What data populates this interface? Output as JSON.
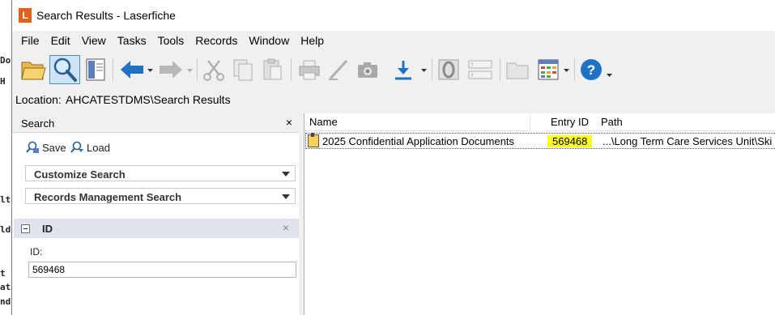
{
  "background_window": {
    "fragments": [
      "Doc",
      "H",
      "lt",
      "ld",
      "t",
      "at",
      "nd"
    ]
  },
  "window": {
    "title": "Search Results - Laserfiche",
    "logo_letter": "L"
  },
  "menu": [
    "File",
    "Edit",
    "View",
    "Tasks",
    "Tools",
    "Records",
    "Window",
    "Help"
  ],
  "toolbar": {
    "buttons": [
      "open-folder-icon",
      "search-icon",
      "preview-pane-icon",
      "back-icon",
      "forward-icon",
      "cut-icon",
      "copy-icon",
      "paste-icon",
      "print-icon",
      "annotate-icon",
      "scan-icon",
      "download-icon",
      "zone-ocr-icon",
      "fields-icon",
      "new-folder-icon",
      "column-view-icon",
      "help-icon"
    ],
    "accent": "#1f73c5"
  },
  "location": {
    "label": "Location:",
    "value": "AHCATESTDMS\\Search Results"
  },
  "search_pane": {
    "title": "Search",
    "close": "×",
    "save_label": "Save",
    "load_label": "Load",
    "customize_search": "Customize Search",
    "records_management_search": "Records Management Search",
    "field_group_title": "ID",
    "field_remove": "×",
    "id_label": "ID:",
    "id_value": "569468"
  },
  "results": {
    "columns": [
      "Name",
      "Entry ID",
      "Path"
    ],
    "rows": [
      {
        "name": "2025 Confidential Application Documents",
        "entry_id": "569468",
        "path": "...\\Long Term Care Services Unit\\Ski"
      }
    ],
    "highlight_color": "#ffff22"
  }
}
